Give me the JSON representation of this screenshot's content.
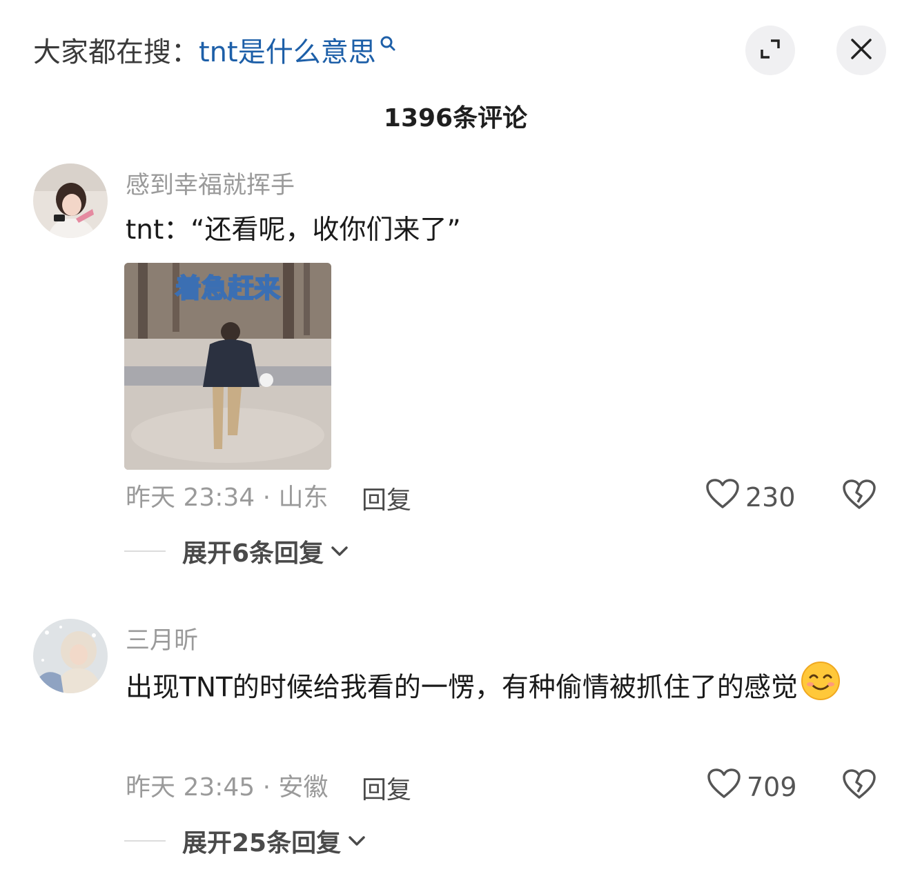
{
  "header": {
    "search_prefix": "大家都在搜：",
    "search_term": "tnt是什么意思",
    "expand_icon": "expand-icon",
    "close_icon": "close-icon"
  },
  "comment_count": "1396条评论",
  "comments": [
    {
      "username": "感到幸福就挥手",
      "text": "tnt：“还看呢，收你们来了”",
      "meme_caption": "着急赶来",
      "time_location": "昨天 23:34 · 山东",
      "reply": "回复",
      "likes": "230",
      "expand_replies": "展开6条回复"
    },
    {
      "username": "三月昕",
      "text": "出现TNT的时候给我看的一愣，有种偷情被抓住了的感觉",
      "emoji": "smiling-face-icon",
      "time_location": "昨天 23:45 · 安徽",
      "reply": "回复",
      "likes": "709",
      "expand_replies": "展开25条回复"
    }
  ],
  "colors": {
    "search_term": "#1d5fa8",
    "muted": "#9a9a9a",
    "button_bg": "#f0f0f2"
  }
}
